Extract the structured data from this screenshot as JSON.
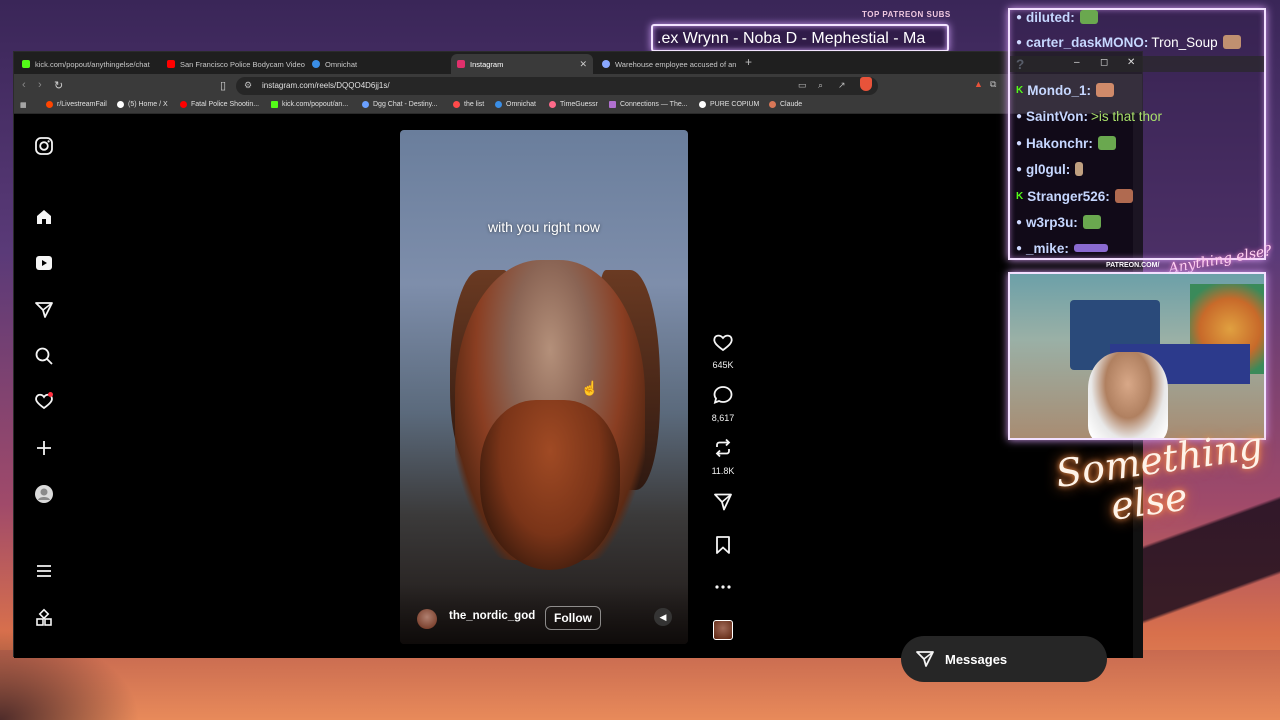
{
  "overlay": {
    "patreon_label": "TOP PATREON SUBS",
    "patreon_names": ".ex Wrynn -  Noba D - Mephestial - Ma",
    "logo_line1": "Something",
    "logo_line2": "else",
    "logo_top": "Anything",
    "logo_top2": "else?",
    "cam_patreon": "PATREON.COM/"
  },
  "browser": {
    "tabs": [
      {
        "label": "kick.com/popout/anythingelse/chat",
        "color": "#53fc18"
      },
      {
        "label": "San Francisco Police Bodycam Video",
        "color": "#ff0000"
      },
      {
        "label": "Omnichat",
        "color": "#3a8ee6"
      },
      {
        "label": "Instagram",
        "color": "#e1306c",
        "active": true
      },
      {
        "label": "Warehouse employee accused of an",
        "color": "#8aa8ff"
      }
    ],
    "url": "instagram.com/reels/DQQO4D6jj1s/",
    "bookmarks": [
      {
        "label": "r/LivestreamFail",
        "color": "#ff4500"
      },
      {
        "label": "(5) Home / X",
        "color": "#ffffff"
      },
      {
        "label": "Fatal Police Shootin...",
        "color": "#ff0000"
      },
      {
        "label": "kick.com/popout/an...",
        "color": "#53fc18"
      },
      {
        "label": "Dgg Chat - Destiny...",
        "color": "#6aa0ff"
      },
      {
        "label": "the list",
        "color": "#ff4a4a"
      },
      {
        "label": "Omnichat",
        "color": "#3a8ee6"
      },
      {
        "label": "TimeGuessr",
        "color": "#ff6a8a"
      },
      {
        "label": "Connections — The...",
        "color": "#b070d0"
      },
      {
        "label": "PURE  COPIUM",
        "color": "#ffffff"
      },
      {
        "label": "Claude",
        "color": "#d97757"
      }
    ]
  },
  "reel": {
    "caption": "with you right now",
    "username": "the_nordic_god",
    "follow_label": "Follow",
    "likes": "645K",
    "comments": "8,617",
    "reposts": "11.8K"
  },
  "messages_label": "Messages",
  "chat": [
    {
      "src": "",
      "user": "diluted:",
      "msg": "",
      "emote": "#6aa84f"
    },
    {
      "src": "kick",
      "user": "carter_daskMONO:",
      "msg": "Tron_Soup",
      "emote": "#c09070"
    },
    {
      "src": "",
      "user": "?",
      "msg": "",
      "emote": ""
    },
    {
      "src": "kick",
      "user": "Mondo_1:",
      "msg": "",
      "emote": "#d08a6a"
    },
    {
      "src": "",
      "user": "SaintVon:",
      "msg": ">is that thor",
      "quote": true,
      "emote": ""
    },
    {
      "src": "",
      "user": "Hakonchr:",
      "msg": "",
      "emote": "#6aa84f"
    },
    {
      "src": "",
      "user": "gl0gul:",
      "msg": "",
      "emote": "#c0a080"
    },
    {
      "src": "kick",
      "user": "Stranger526:",
      "msg": "",
      "emote": "#b06a50"
    },
    {
      "src": "",
      "user": "w3rp3u:",
      "msg": "",
      "emote": "#6aa84f"
    },
    {
      "src": "",
      "user": "_mike:",
      "msg": "",
      "emote": "#8a6ad0"
    }
  ]
}
